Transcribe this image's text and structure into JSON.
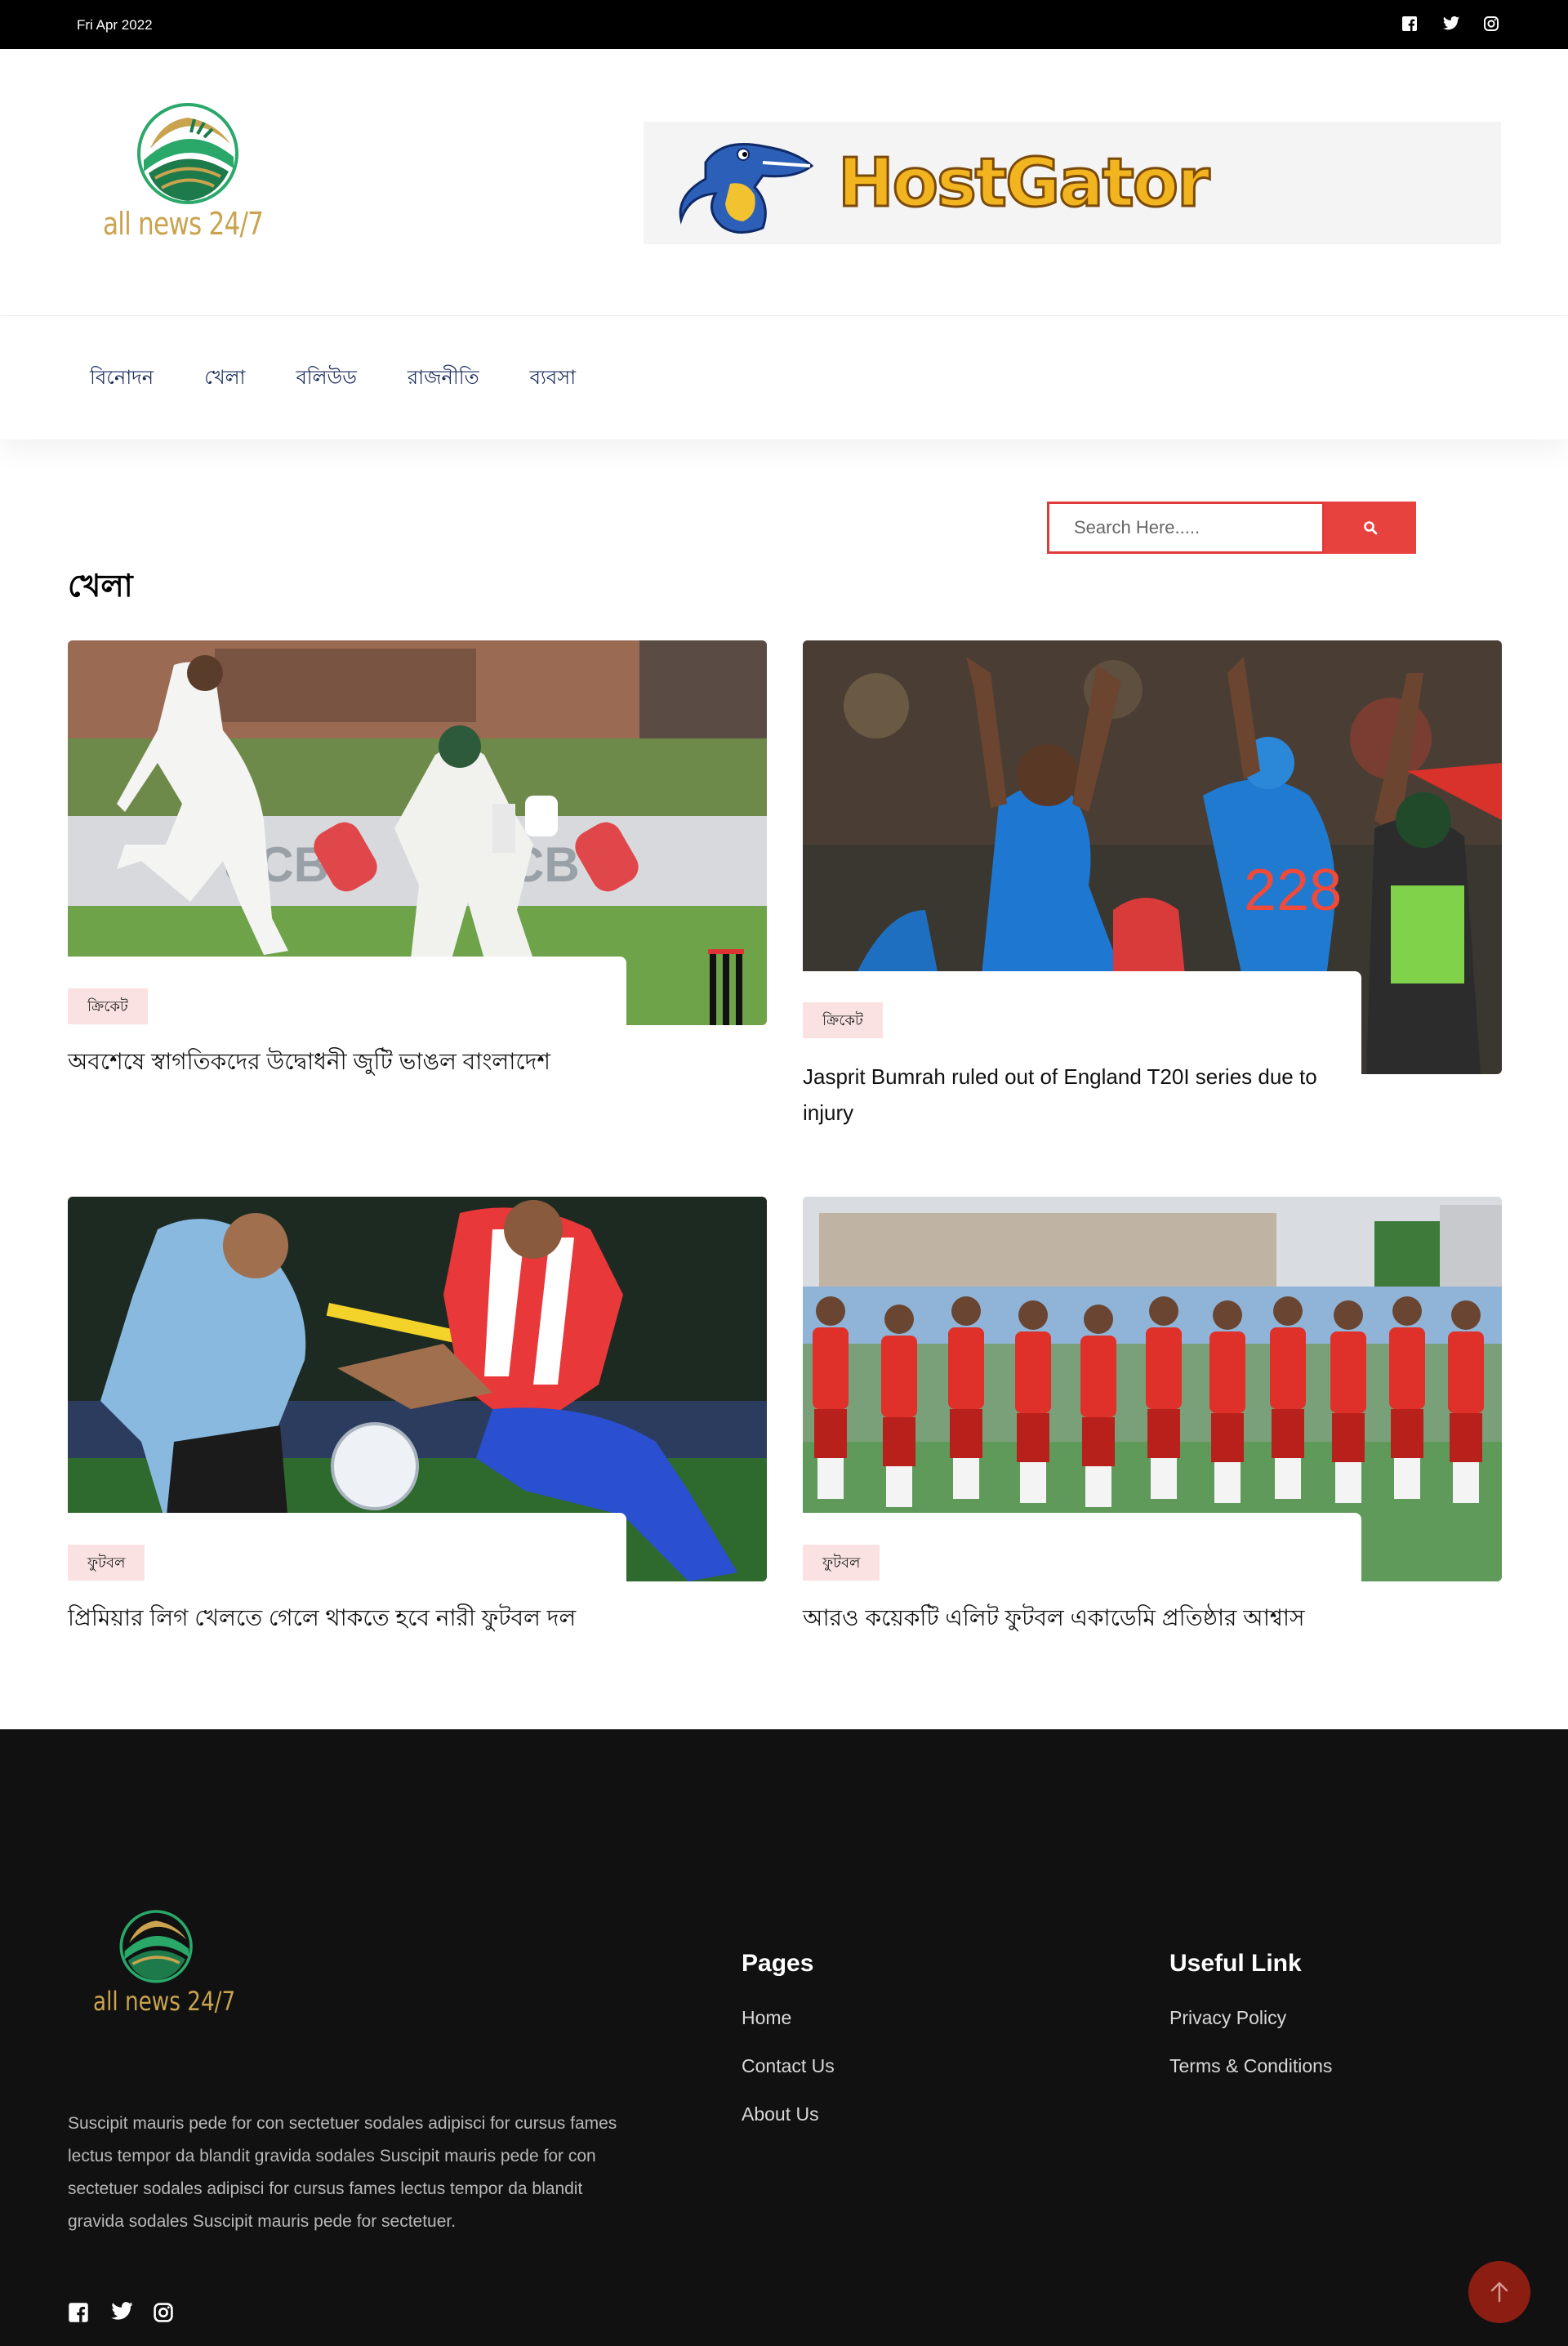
{
  "topbar": {
    "date": "Fri Apr 2022",
    "social": [
      "facebook-icon",
      "twitter-icon",
      "instagram-icon"
    ]
  },
  "header": {
    "logo_text": "all news 24/7",
    "banner_text": "HostGator"
  },
  "nav": {
    "items": [
      "বিনোদন",
      "খেলা",
      "বলিউড",
      "রাজনীতি",
      "ব্যবসা"
    ]
  },
  "search": {
    "placeholder": "Search Here....."
  },
  "section": {
    "title": "খেলা"
  },
  "articles": [
    {
      "tag": "ক্রিকেট",
      "title": "অবশেষে স্বাগতিকদের উদ্বোধনী জুটি ভাঙল বাংলাদেশ"
    },
    {
      "tag": "ক্রিকেট",
      "title": "Jasprit Bumrah ruled out of England T20I series due to injury"
    },
    {
      "tag": "ফুটবল",
      "title": "প্রিমিয়ার লিগ খেলতে গেলে থাকতে হবে নারী ফুটবল দল"
    },
    {
      "tag": "ফুটবল",
      "title": "আরও কয়েকটি এলিট ফুটবল একাডেমি প্রতিষ্ঠার আশ্বাস"
    }
  ],
  "footer": {
    "logo_text": "all news 24/7",
    "description": "Suscipit mauris pede for con sectetuer sodales adipisci for cursus fames lectus tempor da blandit gravida sodales Suscipit mauris pede for con sectetuer sodales adipisci for cursus fames lectus tempor da blandit gravida sodales Suscipit mauris pede for sectetuer.",
    "pages": {
      "heading": "Pages",
      "links": [
        "Home",
        "Contact Us",
        "About Us"
      ]
    },
    "useful": {
      "heading": "Useful Link",
      "links": [
        "Privacy Policy",
        "Terms & Conditions"
      ]
    }
  },
  "colors": {
    "accent": "#e8423f",
    "tag_bg": "#fbe2e2",
    "footer_bg": "#111111",
    "totop": "#8b1d12"
  }
}
